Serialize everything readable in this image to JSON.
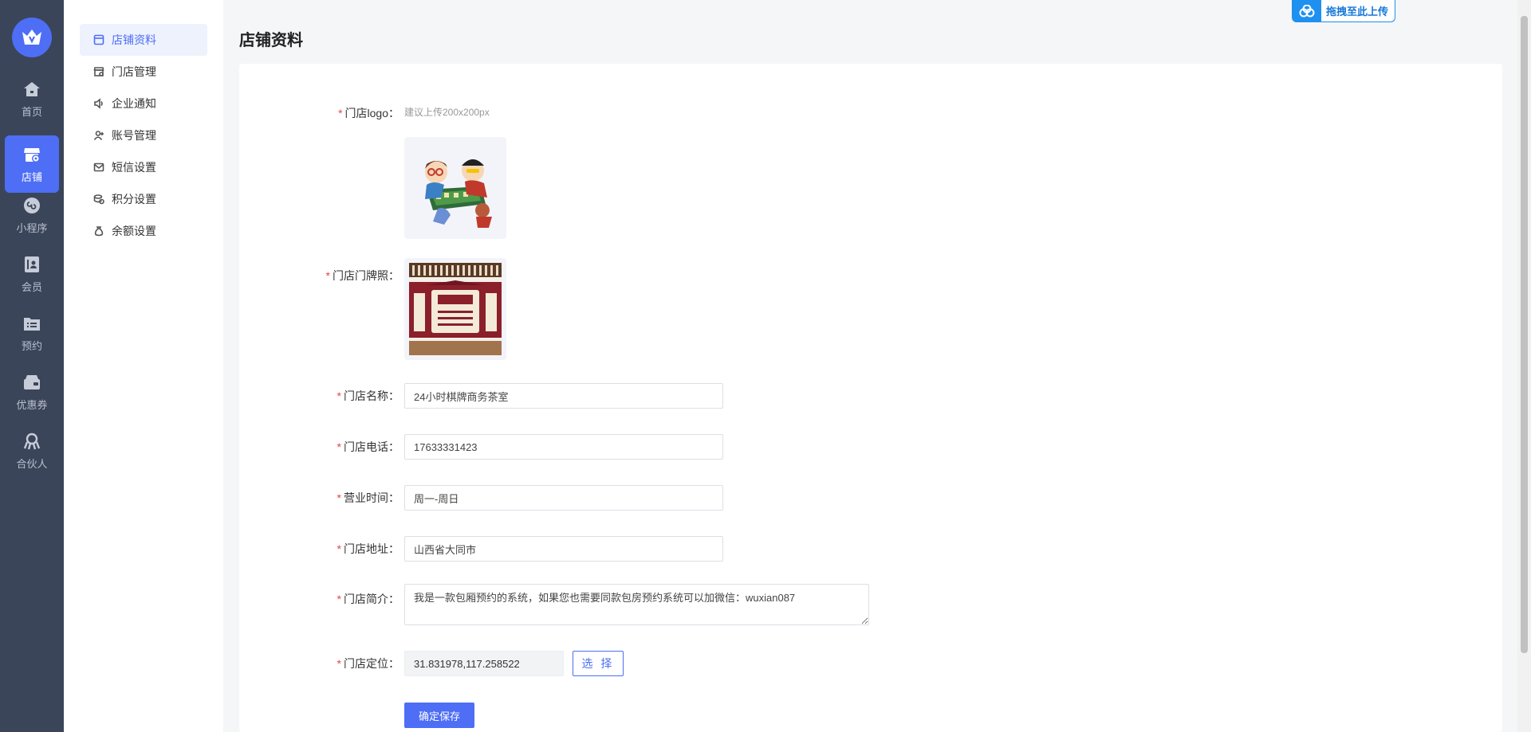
{
  "rail": {
    "items": [
      {
        "label": "首页",
        "icon": "home-icon"
      },
      {
        "label": "店铺",
        "icon": "store-icon",
        "active": true
      },
      {
        "label": "小程序",
        "icon": "mini-program-icon"
      },
      {
        "label": "会员",
        "icon": "member-icon"
      },
      {
        "label": "预约",
        "icon": "reservation-icon"
      },
      {
        "label": "优惠券",
        "icon": "coupon-icon"
      },
      {
        "label": "合伙人",
        "icon": "partner-icon"
      }
    ]
  },
  "submenu": {
    "items": [
      {
        "label": "店铺资料",
        "icon": "shop-info-icon",
        "active": true
      },
      {
        "label": "门店管理",
        "icon": "store-manage-icon"
      },
      {
        "label": "企业通知",
        "icon": "speaker-icon"
      },
      {
        "label": "账号管理",
        "icon": "account-icon"
      },
      {
        "label": "短信设置",
        "icon": "mail-icon"
      },
      {
        "label": "积分设置",
        "icon": "points-icon"
      },
      {
        "label": "余额设置",
        "icon": "balance-icon"
      }
    ]
  },
  "upload_widget": {
    "label": "拖拽至此上传"
  },
  "page": {
    "title": "店铺资料"
  },
  "form": {
    "logo": {
      "label": "门店logo：",
      "hint": "建议上传200x200px"
    },
    "sign_photo": {
      "label": "门店门牌照："
    },
    "name": {
      "label": "门店名称：",
      "value": "24小时棋牌商务茶室"
    },
    "phone": {
      "label": "门店电话：",
      "value": "17633331423"
    },
    "hours": {
      "label": "营业时间：",
      "value": "周一-周日"
    },
    "address": {
      "label": "门店地址：",
      "value": "山西省大同市"
    },
    "intro": {
      "label": "门店简介：",
      "value": "我是一款包厢预约的系统，如果您也需要同款包房预约系统可以加微信：wuxian087"
    },
    "location": {
      "label": "门店定位：",
      "value": "31.831978,117.258522",
      "pick_label": "选 择"
    },
    "save_label": "确定保存"
  },
  "colors": {
    "primary": "#4d6ef5",
    "rail": "#3b4559",
    "required": "#e64545"
  }
}
